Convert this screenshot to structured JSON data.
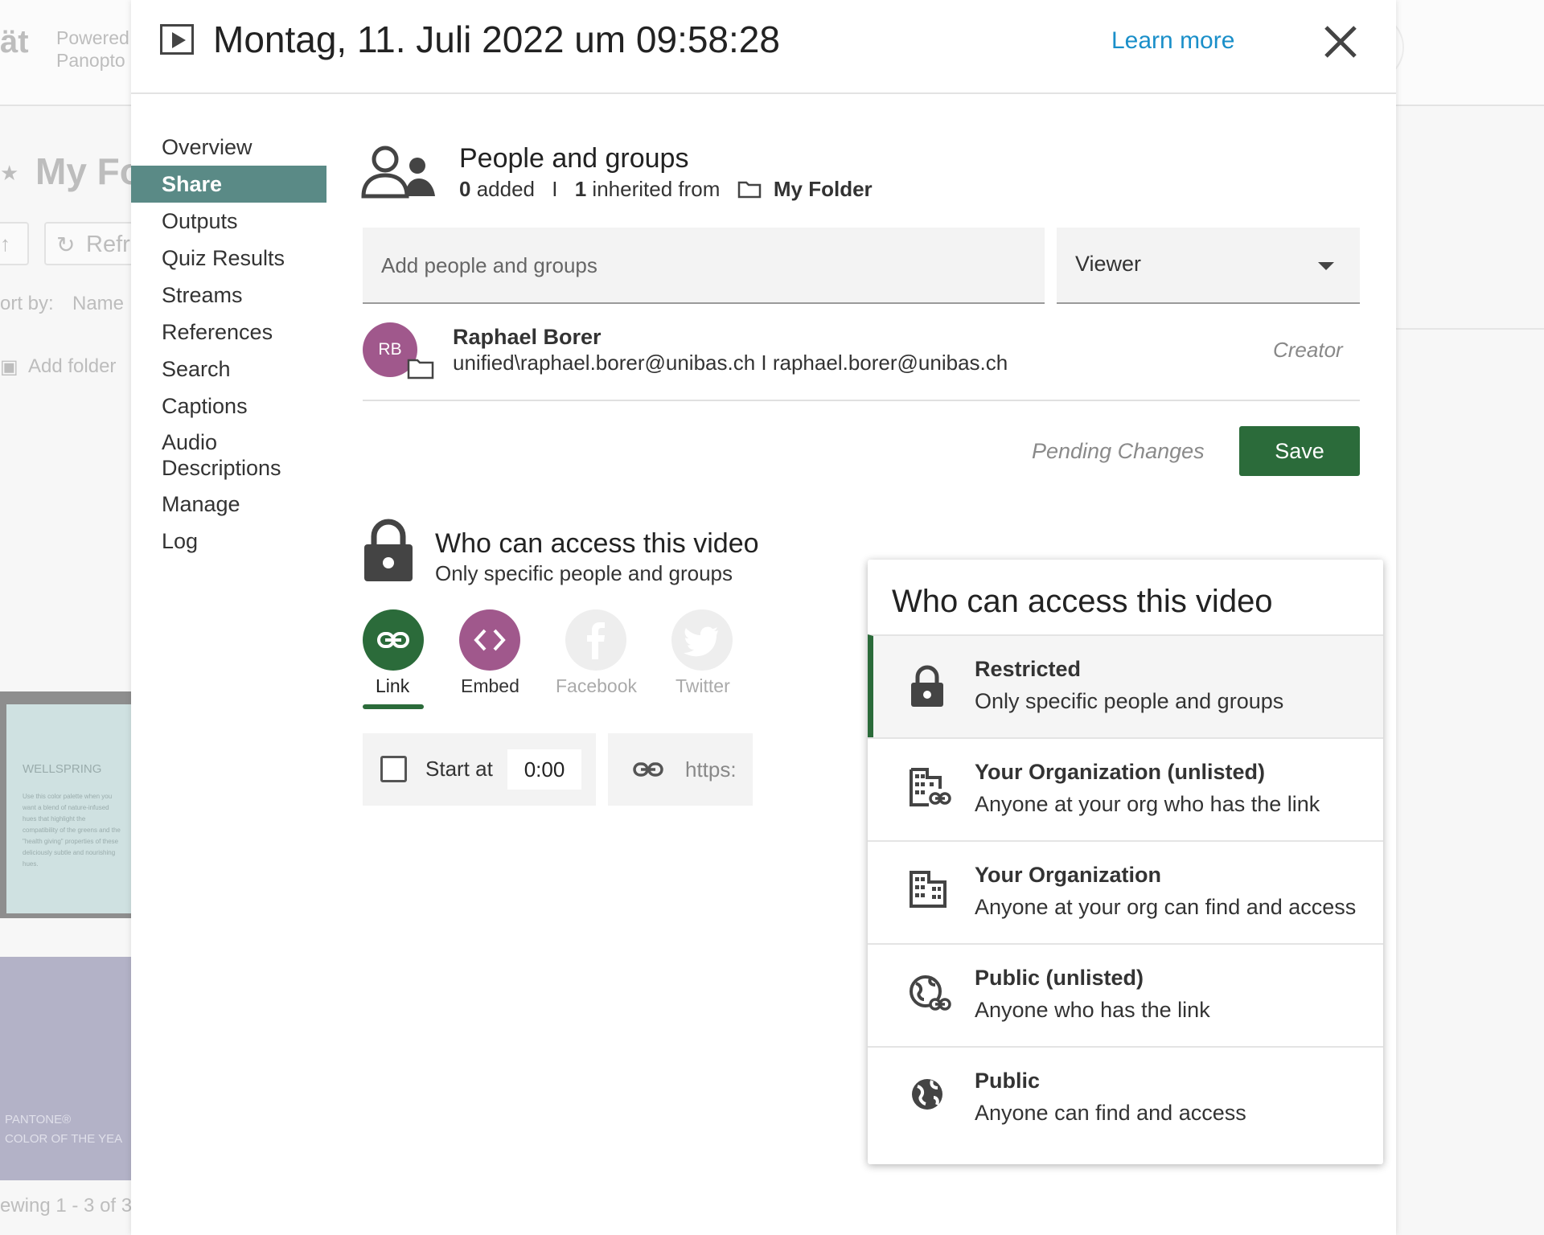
{
  "background": {
    "brand_fragment": "ät",
    "powered_line1": "Powered",
    "powered_line2": "Panopto",
    "folder_title": "My Fo",
    "refresh_label": "Refr",
    "sort_label": "ort by:",
    "sort_value": "Name",
    "add_folder": "Add folder",
    "thumb_title": "WELLSPRING",
    "thumb_body": "Use this color palette when you want a blend of nature-infused hues that highlight the compatibility of the greens and the \"health giving\" properties of these deliciously subtle and nourishing hues.",
    "thumb2_line1": "PANTONE®",
    "thumb2_line2": "COLOR OF THE YEA",
    "footer": "ewing 1 - 3 of 3"
  },
  "header": {
    "title": "Montag, 11. Juli 2022 um 09:58:28",
    "learn_more": "Learn more"
  },
  "nav": [
    {
      "label": "Overview"
    },
    {
      "label": "Share"
    },
    {
      "label": "Outputs"
    },
    {
      "label": "Quiz Results"
    },
    {
      "label": "Streams"
    },
    {
      "label": "References"
    },
    {
      "label": "Search"
    },
    {
      "label": "Captions"
    },
    {
      "label": "Audio Descriptions"
    },
    {
      "label": "Manage"
    },
    {
      "label": "Log"
    }
  ],
  "people": {
    "title": "People and groups",
    "added_count": "0",
    "added_label": "added",
    "separator": "I",
    "inherited_count": "1",
    "inherited_label": "inherited from",
    "folder_name": "My Folder",
    "input_placeholder": "Add people and groups",
    "role": "Viewer"
  },
  "user": {
    "initials": "RB",
    "name": "Raphael Borer",
    "account": "unified\\raphael.borer@unibas.ch I raphael.borer@unibas.ch",
    "role": "Creator"
  },
  "actions": {
    "pending": "Pending Changes",
    "save": "Save"
  },
  "access": {
    "title": "Who can access this video",
    "subtitle": "Only specific people and groups"
  },
  "share_options": [
    {
      "label": "Link",
      "color": "#2b6b3a"
    },
    {
      "label": "Embed",
      "color": "#a0588c"
    },
    {
      "label": "Facebook",
      "color": "#eeeeee"
    },
    {
      "label": "Twitter",
      "color": "#eeeeee"
    }
  ],
  "start": {
    "label": "Start at",
    "time": "0:00"
  },
  "link_fragment": "https:",
  "dropdown": {
    "title": "Who can access this video",
    "options": [
      {
        "title": "Restricted",
        "subtitle": "Only specific people and groups",
        "icon": "lock-icon"
      },
      {
        "title": "Your Organization (unlisted)",
        "subtitle": "Anyone at your org who has the link",
        "icon": "building-link-icon"
      },
      {
        "title": "Your Organization",
        "subtitle": "Anyone at your org can find and access",
        "icon": "building-icon"
      },
      {
        "title": "Public (unlisted)",
        "subtitle": "Anyone who has the link",
        "icon": "globe-link-icon"
      },
      {
        "title": "Public",
        "subtitle": "Anyone can find and access",
        "icon": "globe-icon"
      }
    ]
  },
  "colors": {
    "accent_green": "#2b6b3a",
    "nav_active": "#5a8a86",
    "link_blue": "#1a8fc9",
    "avatar_purple": "#a0588c"
  }
}
